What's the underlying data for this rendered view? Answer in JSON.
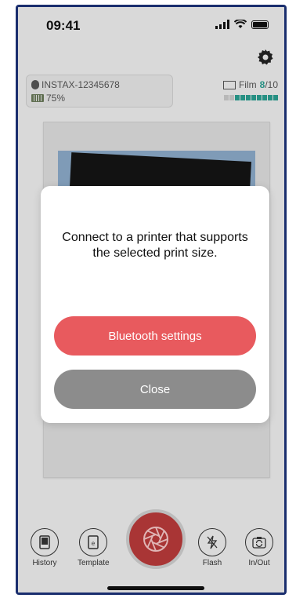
{
  "status_bar": {
    "time": "09:41"
  },
  "printer": {
    "name": "INSTAX-12345678",
    "battery": "75%"
  },
  "film": {
    "label": "Film",
    "remaining": "8",
    "total": "/10",
    "level": 0.8
  },
  "toolbar": {
    "history_label": "History",
    "template_label": "Template",
    "flash_label": "Flash",
    "inout_label": "In/Out"
  },
  "dialog": {
    "message": "Connect to a printer that supports the selected print size.",
    "bluetooth_button": "Bluetooth settings",
    "close_button": "Close"
  },
  "colors": {
    "accent_red": "#e85a5e",
    "shutter_red": "#b83a3a",
    "film_teal": "#2a9d8f",
    "close_gray": "#8c8c8c"
  }
}
